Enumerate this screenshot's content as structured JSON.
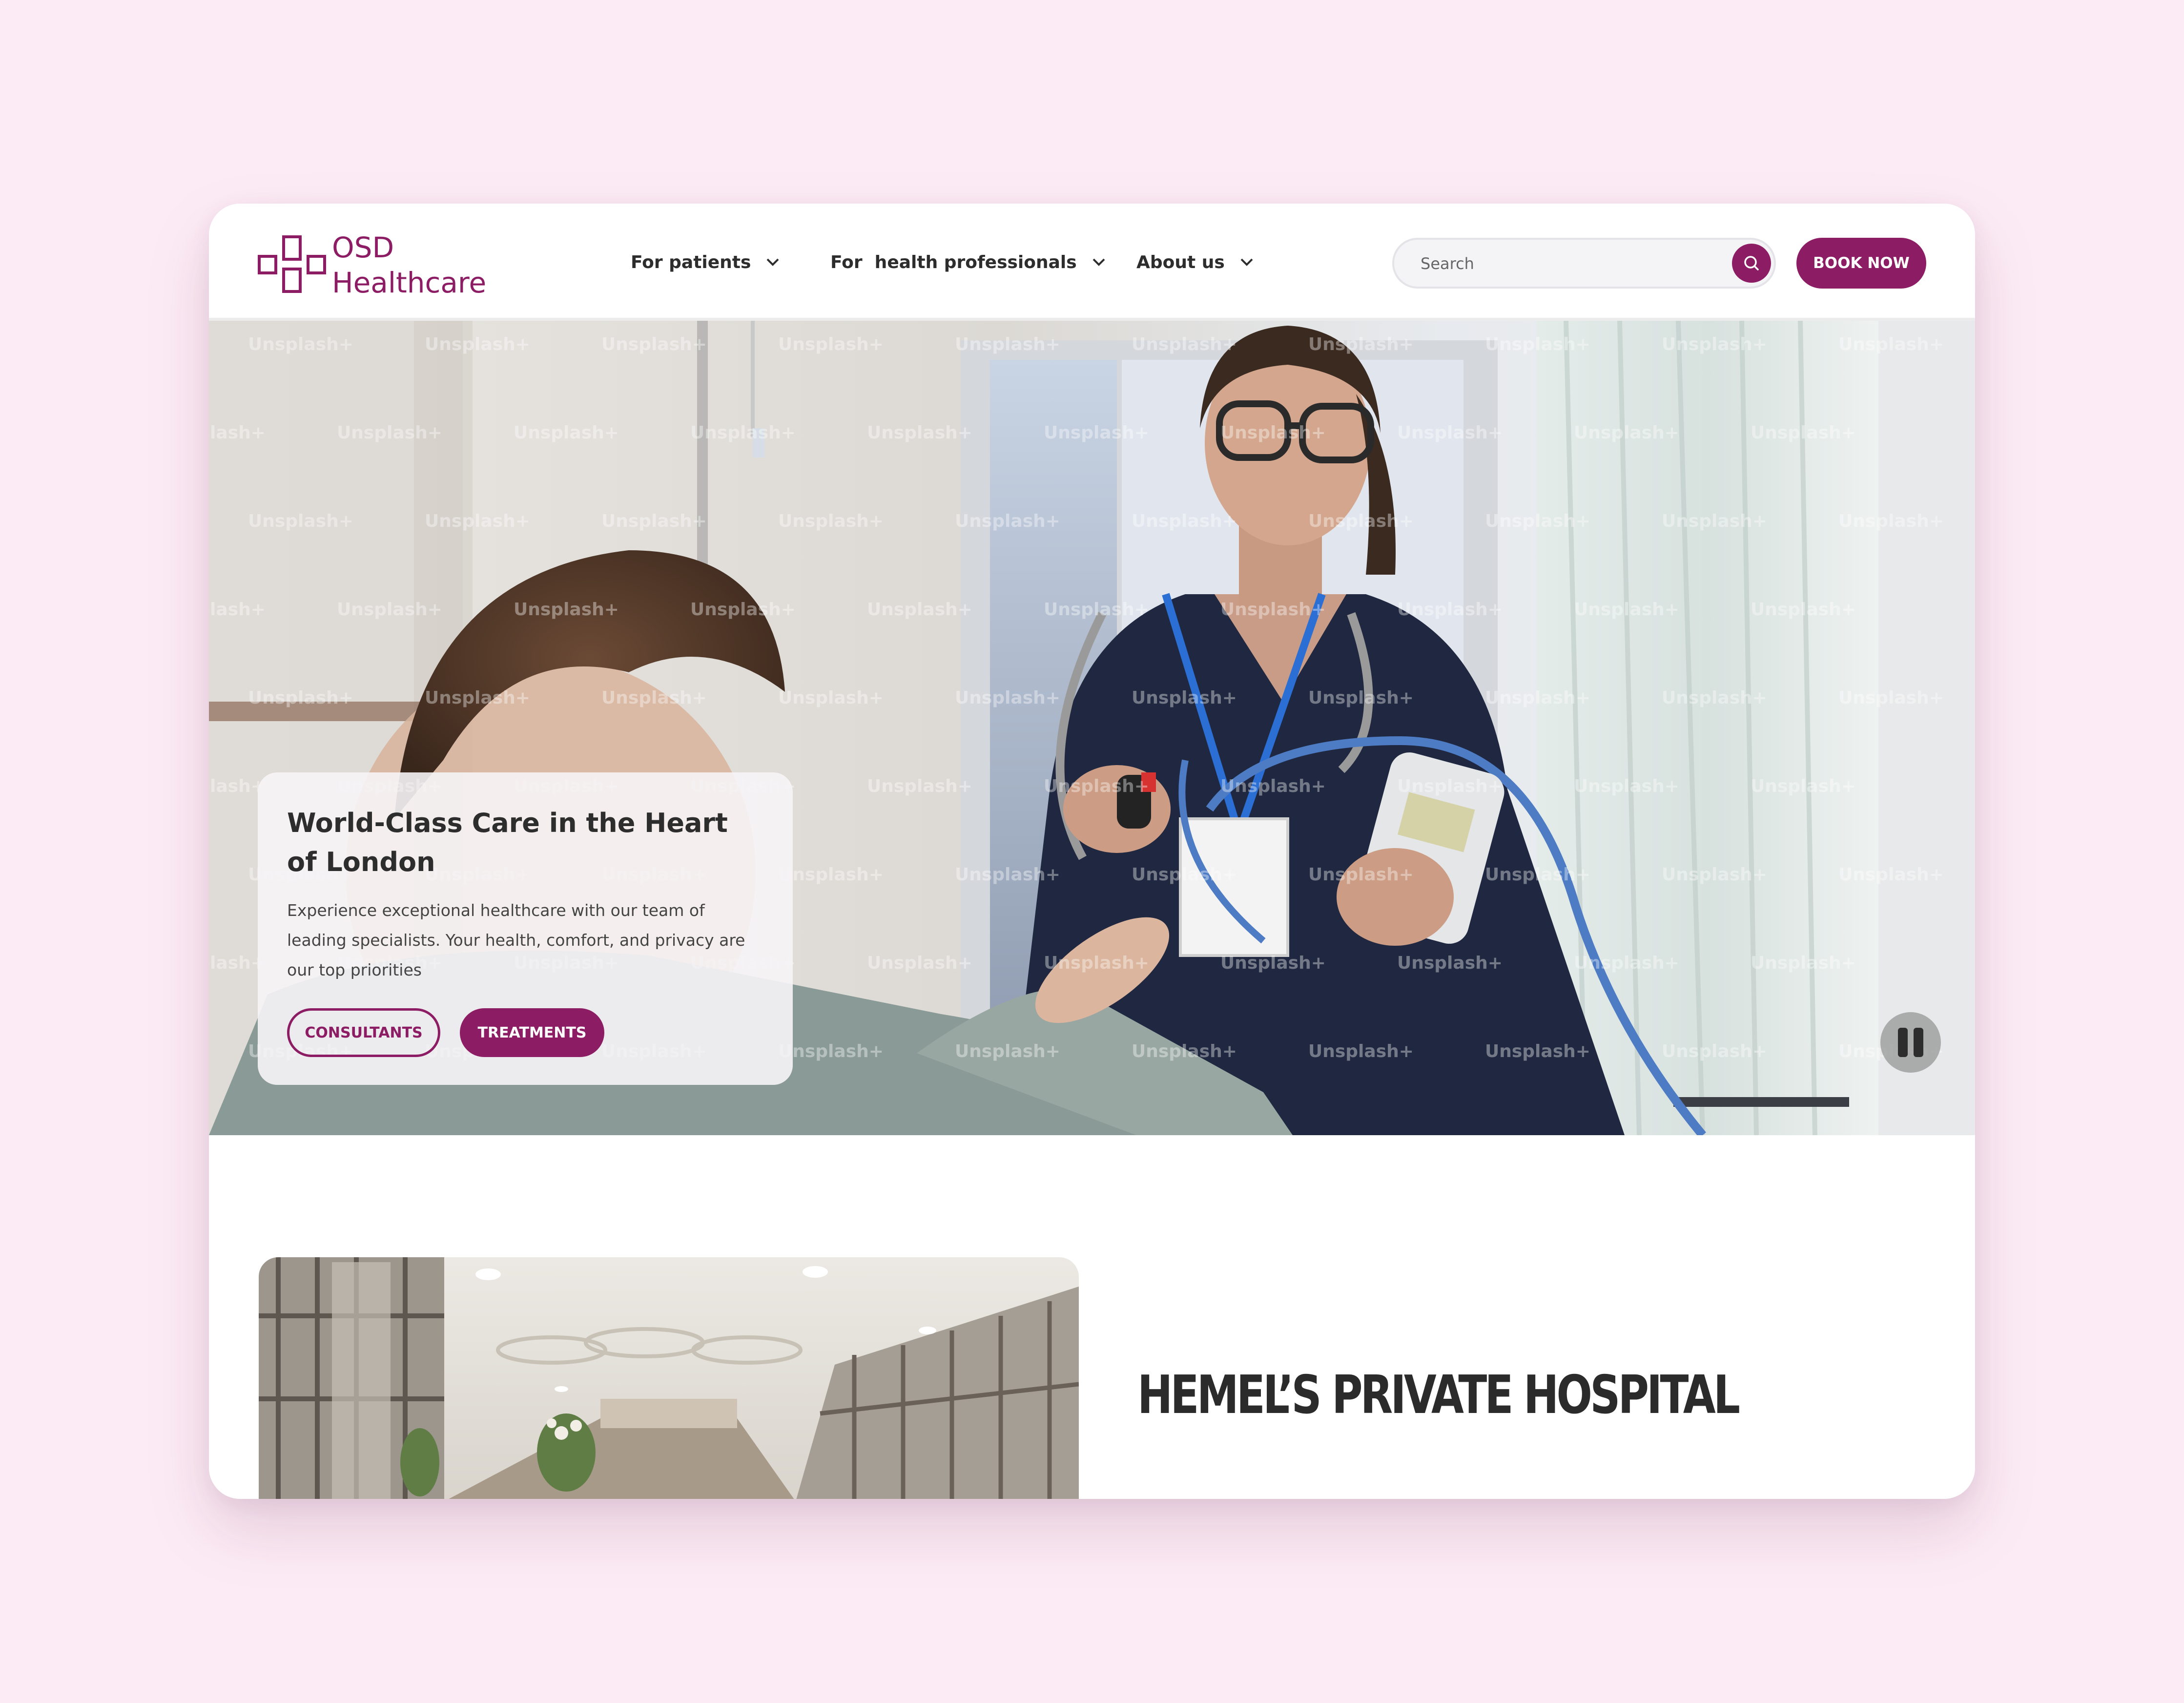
{
  "brand": {
    "line1": "OSD",
    "line2": "Healthcare",
    "logo_icon": "cross-squares-logo-icon",
    "accent_color": "#8c1c63"
  },
  "nav": {
    "items": [
      {
        "label": "For patients",
        "icon": "chevron-down-icon"
      },
      {
        "label": "For  health professionals",
        "icon": "chevron-down-icon"
      },
      {
        "label": "About us",
        "icon": "chevron-down-icon"
      }
    ]
  },
  "search": {
    "placeholder": "Search",
    "icon": "search-icon"
  },
  "header": {
    "book_label": "BOOK NOW"
  },
  "hero": {
    "watermark": "Unsplash+",
    "title": "World-Class Care in the Heart of London",
    "text": "Experience exceptional healthcare with our team of leading specialists. Your health, comfort, and privacy are our top priorities",
    "consultants_label": "CONSULTANTS",
    "treatments_label": "TREATMENTS",
    "pause_icon": "pause-icon"
  },
  "section": {
    "title": "HEMEL’S PRIVATE HOSPITAL"
  }
}
